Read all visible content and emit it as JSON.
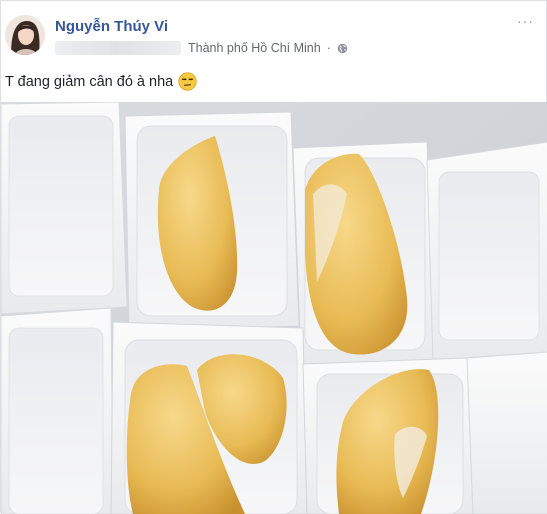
{
  "post": {
    "author_name": "Nguyễn Thúy Vi",
    "location": "Thành phố Hồ Chí Minh",
    "separator": "·",
    "privacy_icon": "globe-icon",
    "menu_icon": "more-horizontal-icon",
    "menu_glyph": "···",
    "message": "T đang giảm cân đó à nha",
    "emoji_icon": "unamused-face-emoji",
    "photo_subject": "durian-in-foam-boxes-photo"
  },
  "colors": {
    "author_link": "#365899",
    "meta_text": "#616770",
    "body_text": "#1d2129",
    "durian_flesh": "#e6b95a"
  }
}
